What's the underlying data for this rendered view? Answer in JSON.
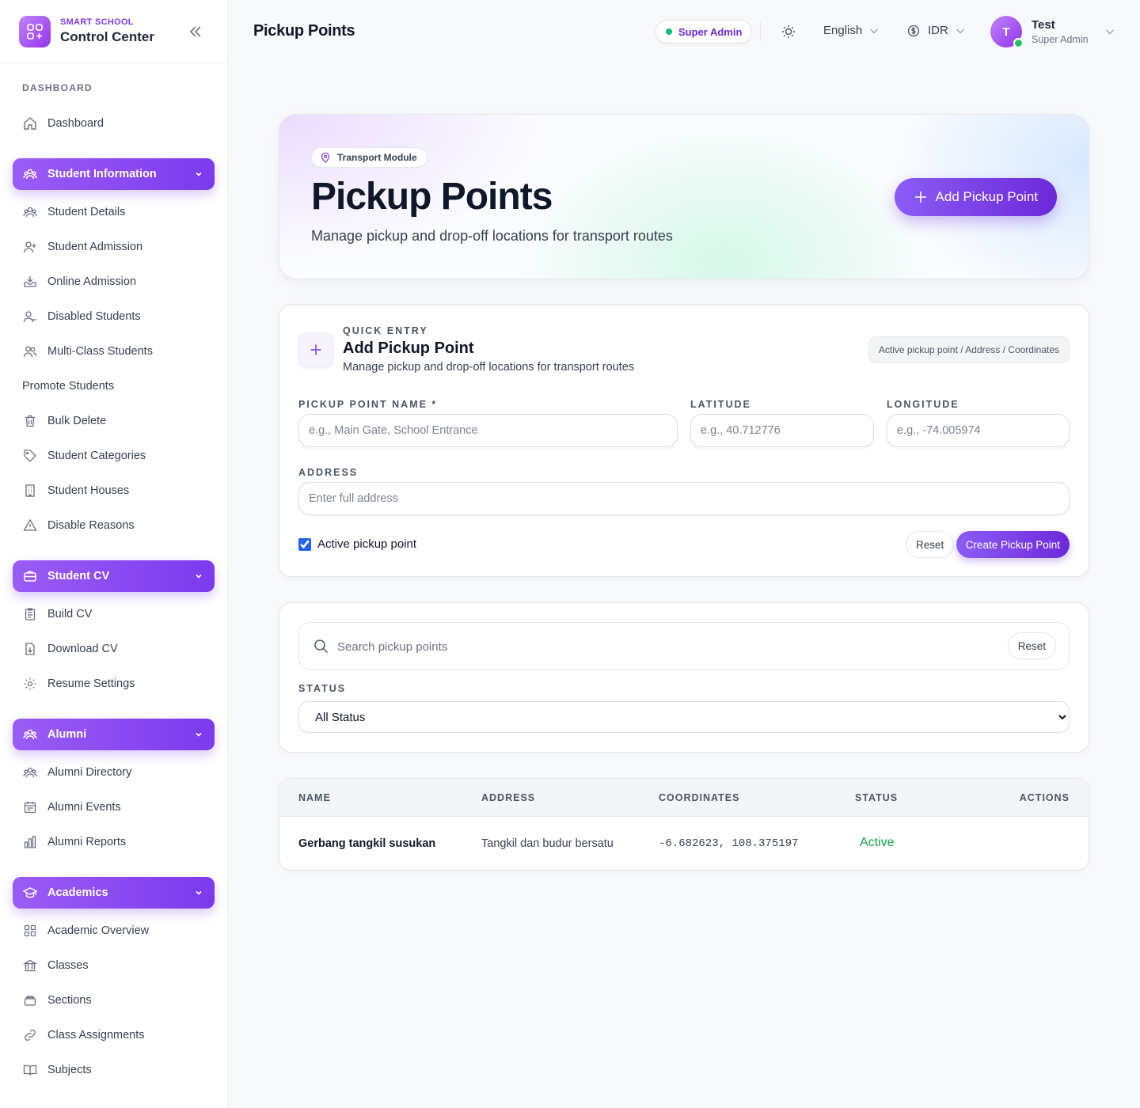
{
  "sidebar": {
    "brand_kicker": "SMART SCHOOL",
    "brand_title": "Control Center",
    "section_label": "DASHBOARD",
    "dashboard": "Dashboard",
    "groups": {
      "student_information": "Student Information",
      "student_cv": "Student CV",
      "alumni": "Alumni",
      "academics": "Academics"
    },
    "student_items": [
      "Student Details",
      "Student Admission",
      "Online Admission",
      "Disabled Students",
      "Multi-Class Students",
      "Promote Students",
      "Bulk Delete",
      "Student Categories",
      "Student Houses",
      "Disable Reasons"
    ],
    "cv_items": [
      "Build CV",
      "Download CV",
      "Resume Settings"
    ],
    "alumni_items": [
      "Alumni Directory",
      "Alumni Events",
      "Alumni Reports"
    ],
    "academic_items": [
      "Academic Overview",
      "Classes",
      "Sections",
      "Class Assignments",
      "Subjects"
    ]
  },
  "topbar": {
    "title": "Pickup Points",
    "role_badge": "Super Admin",
    "language": "English",
    "currency": "IDR",
    "user_initial": "T",
    "user_name": "Test",
    "user_role": "Super Admin"
  },
  "hero": {
    "chip": "Transport Module",
    "title": "Pickup Points",
    "subtitle": "Manage pickup and drop-off locations for transport routes",
    "button": "Add Pickup Point"
  },
  "quick_entry": {
    "kicker": "QUICK ENTRY",
    "title": "Add Pickup Point",
    "subtitle": "Manage pickup and drop-off locations for transport routes",
    "tag": "Active pickup point / Address / Coordinates",
    "name_label": "PICKUP POINT NAME *",
    "name_placeholder": "e.g., Main Gate, School Entrance",
    "lat_label": "LATITUDE",
    "lat_placeholder": "e.g., 40.712776",
    "lng_label": "LONGITUDE",
    "lng_placeholder": "e.g., -74.005974",
    "address_label": "ADDRESS",
    "address_placeholder": "Enter full address",
    "active_label": "Active pickup point",
    "reset": "Reset",
    "create": "Create Pickup Point"
  },
  "filters": {
    "search_placeholder": "Search pickup points",
    "reset": "Reset",
    "status_label": "STATUS",
    "status_value": "All Status"
  },
  "table": {
    "headers": [
      "NAME",
      "ADDRESS",
      "COORDINATES",
      "STATUS",
      "ACTIONS"
    ],
    "rows": [
      {
        "name": "Gerbang tangkil susukan",
        "address": "Tangkil dan budur bersatu",
        "coordinates": "-6.682623, 108.375197",
        "status": "Active"
      }
    ]
  },
  "colors": {
    "accent": "#7c3aed",
    "active": "#16a34a",
    "online": "#22c55e"
  }
}
